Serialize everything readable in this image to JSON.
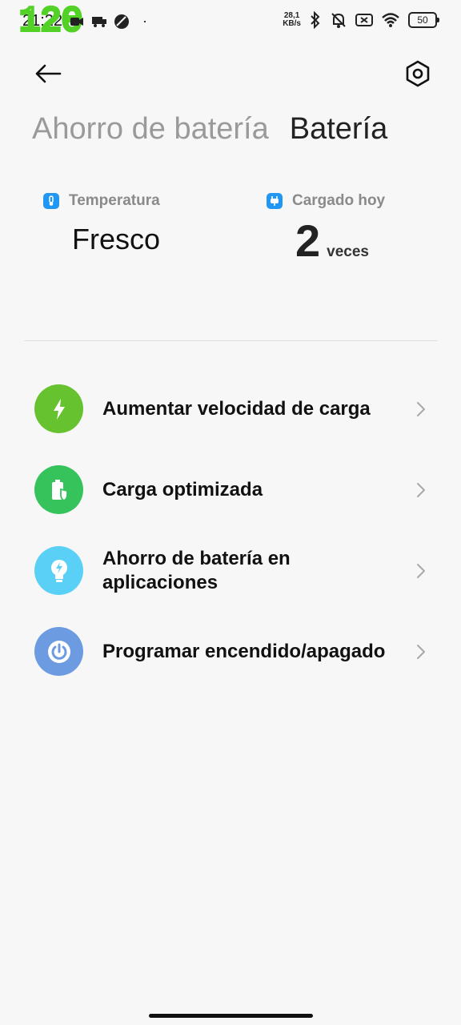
{
  "status_bar": {
    "time": "21:22",
    "overlay_text": "120",
    "speed_value": "28,1",
    "speed_unit": "KB/s",
    "battery": "50",
    "dot": "·"
  },
  "header": {
    "back_icon": "arrow-left-icon",
    "settings_icon": "settings-hexagon-icon"
  },
  "tabs": [
    {
      "label": "Ahorro de batería",
      "active": false
    },
    {
      "label": "Batería",
      "active": true
    }
  ],
  "stats": {
    "temperature": {
      "label": "Temperatura",
      "value": "Fresco",
      "icon": "thermometer-icon",
      "color": "#2196f3"
    },
    "charged": {
      "label": "Cargado hoy",
      "count": "2",
      "unit": "veces",
      "icon": "plug-icon",
      "color": "#2196f3"
    }
  },
  "items": [
    {
      "label": "Aumentar velocidad de carga",
      "icon": "bolt-icon",
      "color": "#66c22e"
    },
    {
      "label": "Carga optimizada",
      "icon": "battery-shield-icon",
      "color": "#37c35c"
    },
    {
      "label": "Ahorro de batería en aplicaciones",
      "icon": "bulb-bolt-icon",
      "color": "#5ad0f7"
    },
    {
      "label": "Programar encendido/apagado",
      "icon": "power-icon",
      "color": "#6c9be1"
    }
  ]
}
